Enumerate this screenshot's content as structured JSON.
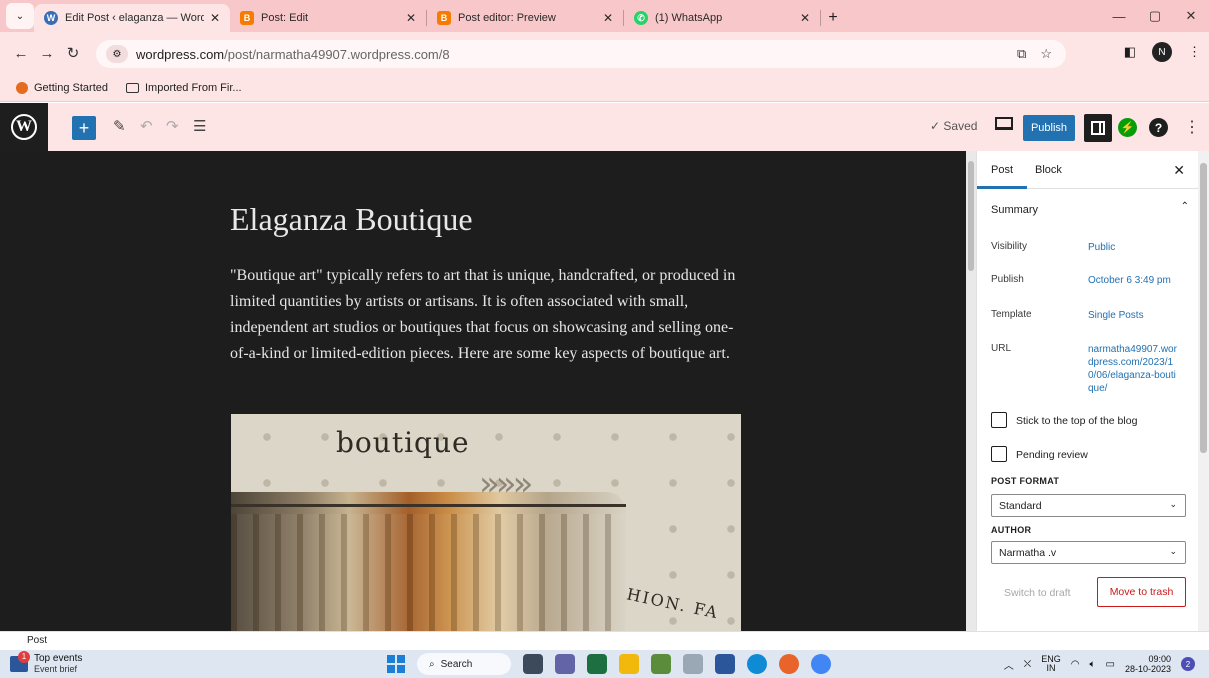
{
  "browser": {
    "tabs": [
      {
        "title": "Edit Post ‹ elaganza — WordPr",
        "icon": "wordpress-icon",
        "active": true
      },
      {
        "title": "Post: Edit",
        "icon": "blogger-icon",
        "active": false
      },
      {
        "title": "Post editor: Preview",
        "icon": "blogger-icon",
        "active": false
      },
      {
        "title": "(1) WhatsApp",
        "icon": "whatsapp-icon",
        "active": false
      }
    ],
    "url_domain": "wordpress.com",
    "url_path": "/post/narmatha49907.wordpress.com/8",
    "profile_initial": "N",
    "bookmarks": [
      {
        "label": "Getting Started",
        "icon": "firefox-icon"
      },
      {
        "label": "Imported From Fir...",
        "icon": "folder-icon"
      }
    ]
  },
  "editor": {
    "saved_label": "✓ Saved",
    "publish_label": "Publish",
    "post_title": "Elaganza Boutique",
    "paragraph": "\"Boutique art\" typically refers to art that is unique, handcrafted, or produced in limited quantities by artists or artisans. It is often associated with small, independent art studios or boutiques that focus on showcasing and selling one-of-a-kind or limited-edition pieces. Here are some key aspects of boutique art.",
    "image_word": "boutique",
    "image_word2": "HION. FA"
  },
  "sidebar": {
    "tab_post": "Post",
    "tab_block": "Block",
    "summary_label": "Summary",
    "rows": {
      "visibility_label": "Visibility",
      "visibility_value": "Public",
      "publish_label": "Publish",
      "publish_value": "October 6 3:49 pm",
      "template_label": "Template",
      "template_value": "Single Posts",
      "url_label": "URL",
      "url_value": "narmatha49907.wordpress.com/2023/10/06/elaganza-boutique/"
    },
    "stick_label": "Stick to the top of the blog",
    "pending_label": "Pending review",
    "post_format_label": "POST FORMAT",
    "post_format_value": "Standard",
    "author_label": "AUTHOR",
    "author_value": "Narmatha .v",
    "switch_draft": "Switch to draft",
    "move_trash": "Move to trash"
  },
  "footer": {
    "breadcrumb": "Post"
  },
  "taskbar": {
    "news_title": "Top events",
    "news_sub": "Event brief",
    "news_badge": "1",
    "search_label": "Search",
    "lang_top": "ENG",
    "lang_bottom": "IN",
    "time": "09:00",
    "date": "28-10-2023",
    "notif_count": "2"
  },
  "colors": {
    "wp_blue": "#2271b1",
    "browser_pink": "#f8c7c9",
    "canvas_dark": "#1d1d1d",
    "trash_red": "#cc1818"
  }
}
